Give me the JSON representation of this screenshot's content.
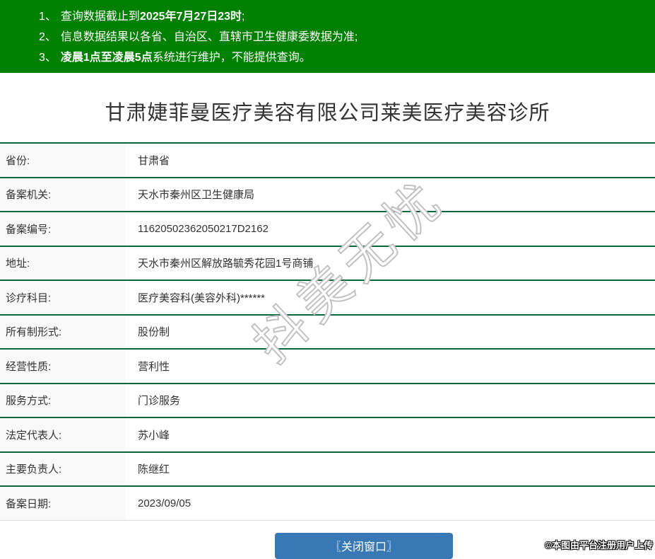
{
  "notice": {
    "bg_color": "#008000",
    "items": [
      {
        "num": "1、",
        "pre": "查询数据截止到",
        "bold": "2025年7月27日23时",
        "post": ";"
      },
      {
        "num": "2、",
        "pre": "信息数据结果以各省、自治区、直辖市卫生健康委数据为准;",
        "bold": "",
        "post": ""
      },
      {
        "num": "3、",
        "pre": "",
        "bold": "凌晨1点至凌晨5点",
        "post": "系统进行维护，不能提供查询。"
      }
    ]
  },
  "title": "甘肃婕菲曼医疗美容有限公司莱美医疗美容诊所",
  "table": {
    "label_bg_color": "#f9f9f9",
    "divider_color": "#05683B",
    "rows": [
      {
        "label": "省份:",
        "value": "甘肃省"
      },
      {
        "label": "备案机关:",
        "value": "天水市秦州区卫生健康局"
      },
      {
        "label": "备案编号:",
        "value": "11620502362050217D2162"
      },
      {
        "label": "地址:",
        "value": "天水市秦州区解放路毓秀花园1号商铺"
      },
      {
        "label": "诊疗科目:",
        "value": "医疗美容科(美容外科)******"
      },
      {
        "label": "所有制形式:",
        "value": "股份制"
      },
      {
        "label": "经营性质:",
        "value": "营利性"
      },
      {
        "label": "服务方式:",
        "value": "门诊服务"
      },
      {
        "label": "法定代表人:",
        "value": "苏小峰"
      },
      {
        "label": "主要负责人:",
        "value": "陈继红"
      },
      {
        "label": "备案日期:",
        "value": "2023/09/05"
      }
    ]
  },
  "button": {
    "label": "〖关闭窗口〗",
    "bg_color": "#3878b4"
  },
  "watermarks": {
    "center": "抖美无忧",
    "bottom_right": "©本图由平台注册用户上传"
  }
}
